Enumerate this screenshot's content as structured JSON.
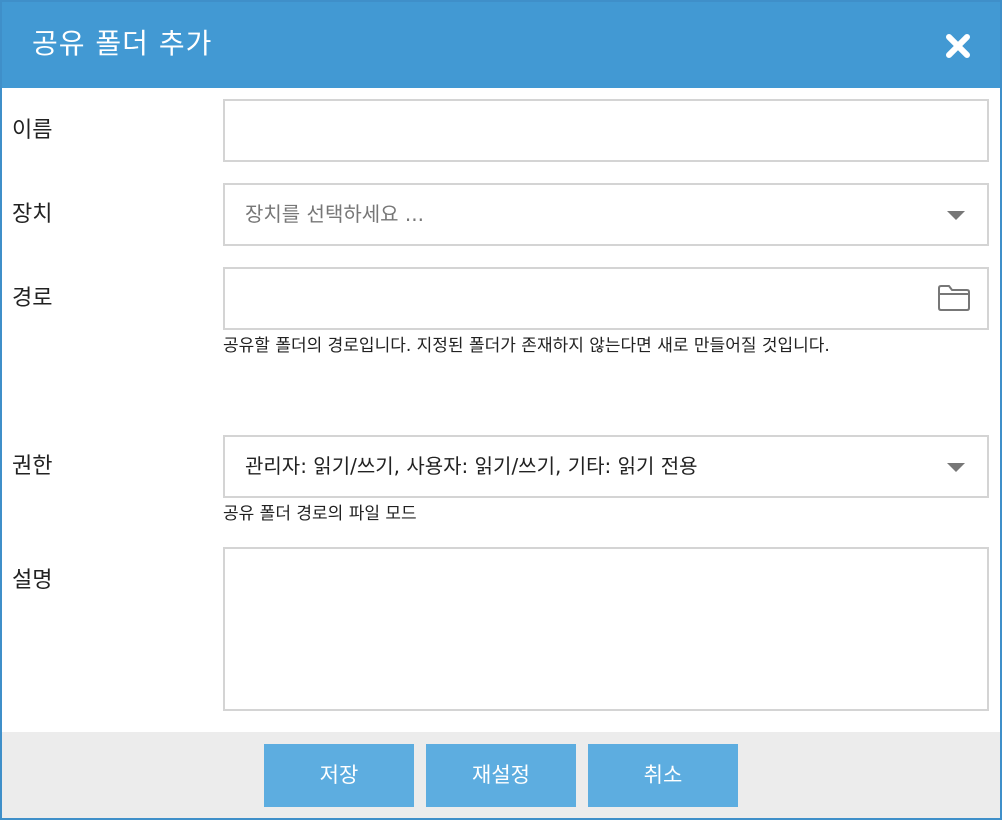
{
  "dialog": {
    "title": "공유 폴더 추가",
    "close_icon": "close-icon"
  },
  "form": {
    "name": {
      "label": "이름",
      "value": "",
      "placeholder": ""
    },
    "device": {
      "label": "장치",
      "placeholder": "장치를 선택하세요 ...",
      "icon": "chevron-down-icon"
    },
    "path": {
      "label": "경로",
      "value": "",
      "icon": "folder-icon",
      "help": "공유할 폴더의 경로입니다. 지정된 폴더가 존재하지 않는다면 새로 만들어질 것입니다."
    },
    "permission": {
      "label": "권한",
      "selected": "관리자: 읽기/쓰기, 사용자: 읽기/쓰기, 기타: 읽기 전용",
      "icon": "chevron-down-icon",
      "help": "공유 폴더 경로의 파일 모드"
    },
    "description": {
      "label": "설명",
      "value": ""
    }
  },
  "footer": {
    "save_label": "저장",
    "reset_label": "재설정",
    "cancel_label": "취소"
  },
  "colors": {
    "titlebar": "#4299d3",
    "button": "#5dade0",
    "footer_bg": "#ececec",
    "border": "#d4d4d4"
  }
}
